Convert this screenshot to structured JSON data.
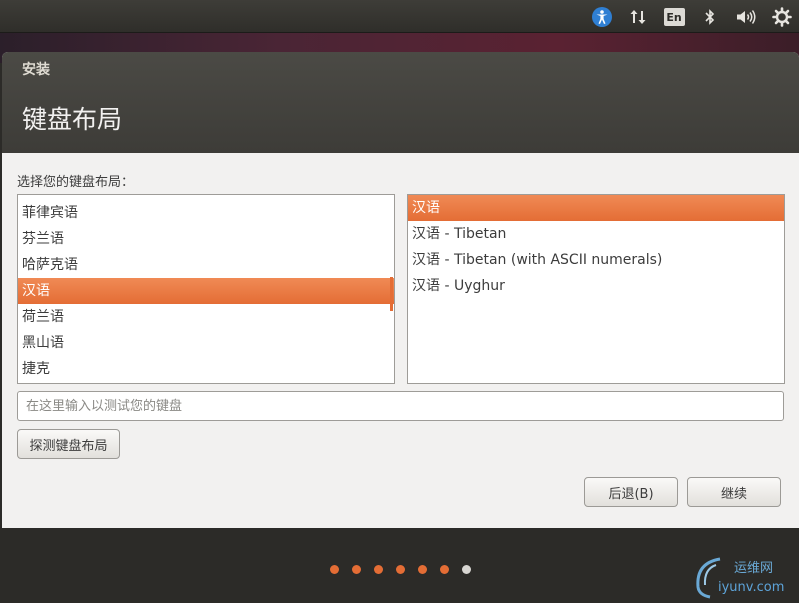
{
  "top_panel": {
    "indicators": [
      {
        "icon": "accessibility-icon"
      },
      {
        "icon": "network-icon"
      },
      {
        "icon": "keyboard-language-icon",
        "label": "En"
      },
      {
        "icon": "bluetooth-icon"
      },
      {
        "icon": "volume-icon"
      },
      {
        "icon": "session-gear-icon"
      }
    ]
  },
  "window": {
    "app_title": "安装",
    "page_title": "键盘布局"
  },
  "keyboard": {
    "prompt": "选择您的键盘布局：",
    "layouts": [
      "菲律宾语",
      "芬兰语",
      "哈萨克语",
      "汉语",
      "荷兰语",
      "黑山语",
      "捷克"
    ],
    "selected_layout": "汉语",
    "variants": [
      "汉语",
      "汉语 - Tibetan",
      "汉语 - Tibetan (with ASCII numerals)",
      "汉语 - Uyghur"
    ],
    "selected_variant": "汉语",
    "test_placeholder": "在这里输入以测试您的键盘",
    "detect_button": "探测键盘布局"
  },
  "navigation": {
    "back_button": "后退(B)",
    "continue_button": "继续"
  },
  "progress": {
    "total_steps": 7,
    "current_step": 7
  },
  "watermark": {
    "cn": "运维网",
    "en": "iyunv.com"
  },
  "colors": {
    "accent": "#e46d35",
    "titlebar": "#3d3c38",
    "window_bg": "#f2f1f0"
  }
}
